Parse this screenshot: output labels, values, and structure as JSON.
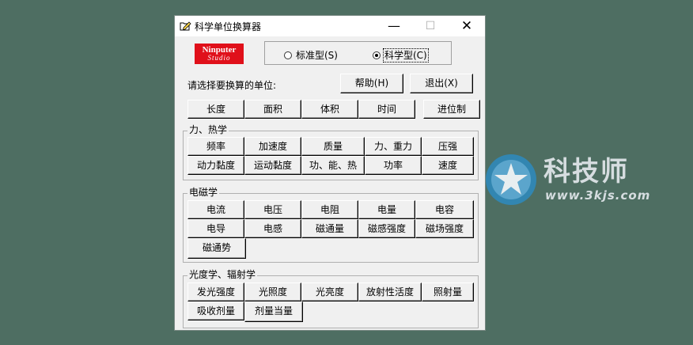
{
  "window": {
    "title": "科学单位换算器",
    "minimize": "—",
    "maximize": "☐",
    "close": "✕"
  },
  "logo": {
    "main": "Ninputer",
    "sub": "Studio"
  },
  "mode": {
    "standard_label": "标准型(S)",
    "scientific_label": "科学型(C)",
    "selected": "scientific"
  },
  "prompt": "请选择要换算的单位:",
  "buttons": {
    "help": "帮助(H)",
    "exit": "退出(X)"
  },
  "basic_units": [
    "长度",
    "面积",
    "体积",
    "时间"
  ],
  "radix_button": "进位制",
  "groups": {
    "mechanics": {
      "title": "力、热学",
      "items": [
        "频率",
        "加速度",
        "质量",
        "力、重力",
        "压强",
        "动力黏度",
        "运动黏度",
        "功、能、热",
        "功率",
        "速度"
      ]
    },
    "electromagnetism": {
      "title": "电磁学",
      "items": [
        "电流",
        "电压",
        "电阻",
        "电量",
        "电容",
        "电导",
        "电感",
        "磁通量",
        "磁感强度",
        "磁场强度",
        "磁通势"
      ]
    },
    "optics": {
      "title": "光度学、辐射学",
      "items": [
        "发光强度",
        "光照度",
        "光亮度",
        "放射性活度",
        "照射量",
        "吸收剂量",
        "剂量当量"
      ]
    }
  },
  "watermark": {
    "title": "科技师",
    "url": "www.3kjs.com"
  },
  "colors": {
    "desktop": "#4e6e62",
    "logo_bg": "#e0101a",
    "watermark": "#d6dde0"
  }
}
